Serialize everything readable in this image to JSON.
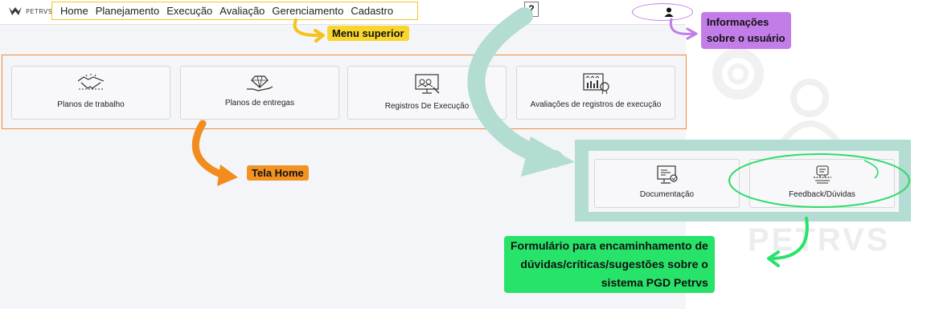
{
  "brand": {
    "name": "PETRVS"
  },
  "menu": {
    "items": [
      "Home",
      "Planejamento",
      "Execução",
      "Avaliação",
      "Gerenciamento",
      "Cadastro"
    ]
  },
  "help": {
    "label": "?"
  },
  "home_cards": [
    {
      "label": "Planos de trabalho",
      "icon": "handshake-icon"
    },
    {
      "label": "Planos de entregas",
      "icon": "diamond-hand-icon"
    },
    {
      "label": "Registros De Execução",
      "icon": "presentation-board-icon"
    },
    {
      "label": "Avaliações de registros de execução",
      "icon": "rating-chart-icon"
    }
  ],
  "help_cards": [
    {
      "label": "Documentação",
      "icon": "document-monitor-icon"
    },
    {
      "label": "Feedback/Dúvidas",
      "icon": "feedback-icon"
    }
  ],
  "annotations": {
    "menu": "Menu superior",
    "home": "Tela Home",
    "user_line1": "Informações",
    "user_line2": "sobre o usuário",
    "form_line1": "Formulário para encaminhamento de",
    "form_line2": "dúvidas/críticas/sugestões sobre o",
    "form_line3": "sistema PGD Petrvs"
  },
  "watermark": {
    "text": "PETRVS"
  },
  "colors": {
    "menu_highlight": "#f2c61f",
    "home_highlight": "#f08a3c",
    "user_highlight": "#c27de8",
    "form_highlight": "#27e36a",
    "panel": "#b3dcd2"
  }
}
